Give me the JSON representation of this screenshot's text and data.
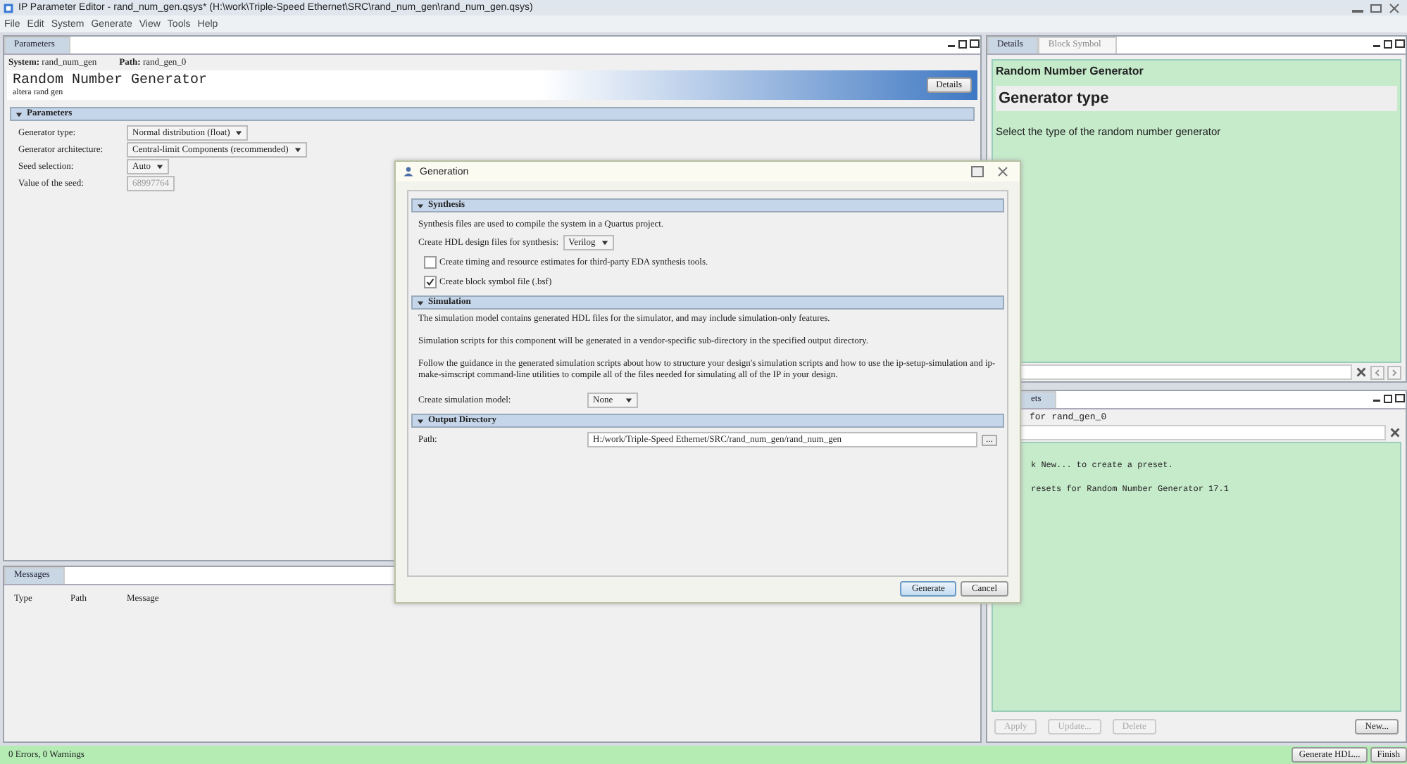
{
  "window": {
    "title": "IP Parameter Editor - rand_num_gen.qsys* (H:\\work\\Triple-Speed Ethernet\\SRC\\rand_num_gen\\rand_num_gen.qsys)"
  },
  "menu": [
    "File",
    "Edit",
    "System",
    "Generate",
    "View",
    "Tools",
    "Help"
  ],
  "parameters_panel": {
    "tab": {
      "label": "Parameters",
      "selected": true
    },
    "system_label": "System:",
    "system": "rand_num_gen",
    "path_label": "Path:",
    "path": "rand_gen_0",
    "title": "Random Number Generator",
    "subtitle": "altera rand gen",
    "details_button": "Details",
    "section": "Parameters",
    "fields": [
      {
        "label": "Generator type:",
        "value": "Normal distribution (float)",
        "kind": "dropdown",
        "disabled": false
      },
      {
        "label": "Generator architecture:",
        "value": "Central-limit Components (recommended)",
        "kind": "dropdown",
        "disabled": false
      },
      {
        "label": "Seed selection:",
        "value": "Auto",
        "kind": "dropdown",
        "disabled": false
      },
      {
        "label": "Value of the seed:",
        "value": "68997764",
        "kind": "text",
        "disabled": true
      }
    ]
  },
  "messages_panel": {
    "tab": {
      "label": "Messages",
      "selected": true
    },
    "columns": [
      "Type",
      "Path",
      "Message"
    ]
  },
  "details_panel": {
    "tabs": [
      {
        "label": "Details",
        "selected": true
      },
      {
        "label": "Block Symbol",
        "selected": false
      }
    ],
    "component": "Random Number Generator",
    "heading": "Generator type",
    "description": "Select the type of the random number generator"
  },
  "presets_panel": {
    "tab": {
      "label": "ets",
      "selected": true
    },
    "header": "for rand_gen_0",
    "lines": [
      "k New... to create a preset.",
      "resets for Random Number Generator 17.1"
    ],
    "buttons": [
      {
        "label": "Apply",
        "disabled": true
      },
      {
        "label": "Update...",
        "disabled": true
      },
      {
        "label": "Delete",
        "disabled": true
      },
      {
        "label": "New...",
        "disabled": false
      }
    ]
  },
  "status_bar": {
    "text": "0 Errors, 0 Warnings",
    "buttons": [
      "Generate HDL...",
      "Finish"
    ]
  },
  "dialog": {
    "title": "Generation",
    "synthesis": {
      "heading": "Synthesis",
      "text": "Synthesis files are used to compile the system in a Quartus project.",
      "hdl_label": "Create HDL design files for synthesis:",
      "hdl_value": "Verilog",
      "checkboxes": [
        {
          "label": "Create timing and resource estimates for third-party EDA synthesis tools.",
          "checked": false
        },
        {
          "label": "Create block symbol file (.bsf)",
          "checked": true
        }
      ]
    },
    "simulation": {
      "heading": "Simulation",
      "paragraphs": [
        "The simulation model contains generated HDL files for the simulator, and may include simulation-only features.",
        "Simulation scripts for this component will be generated in a vendor-specific sub-directory in the specified output directory.",
        "Follow the guidance in the generated simulation scripts about how to structure your design's simulation scripts and how to use the ip-setup-simulation and ip-make-simscript command-line utilities to compile all of the files needed for simulating all of the IP in your design."
      ],
      "model_label": "Create simulation model:",
      "model_value": "None"
    },
    "output": {
      "heading": "Output Directory",
      "path_label": "Path:",
      "path": "H:/work/Triple-Speed Ethernet/SRC/rand_num_gen/rand_num_gen",
      "browse": "..."
    },
    "buttons": [
      {
        "label": "Generate",
        "primary": true
      },
      {
        "label": "Cancel",
        "primary": false
      }
    ]
  }
}
